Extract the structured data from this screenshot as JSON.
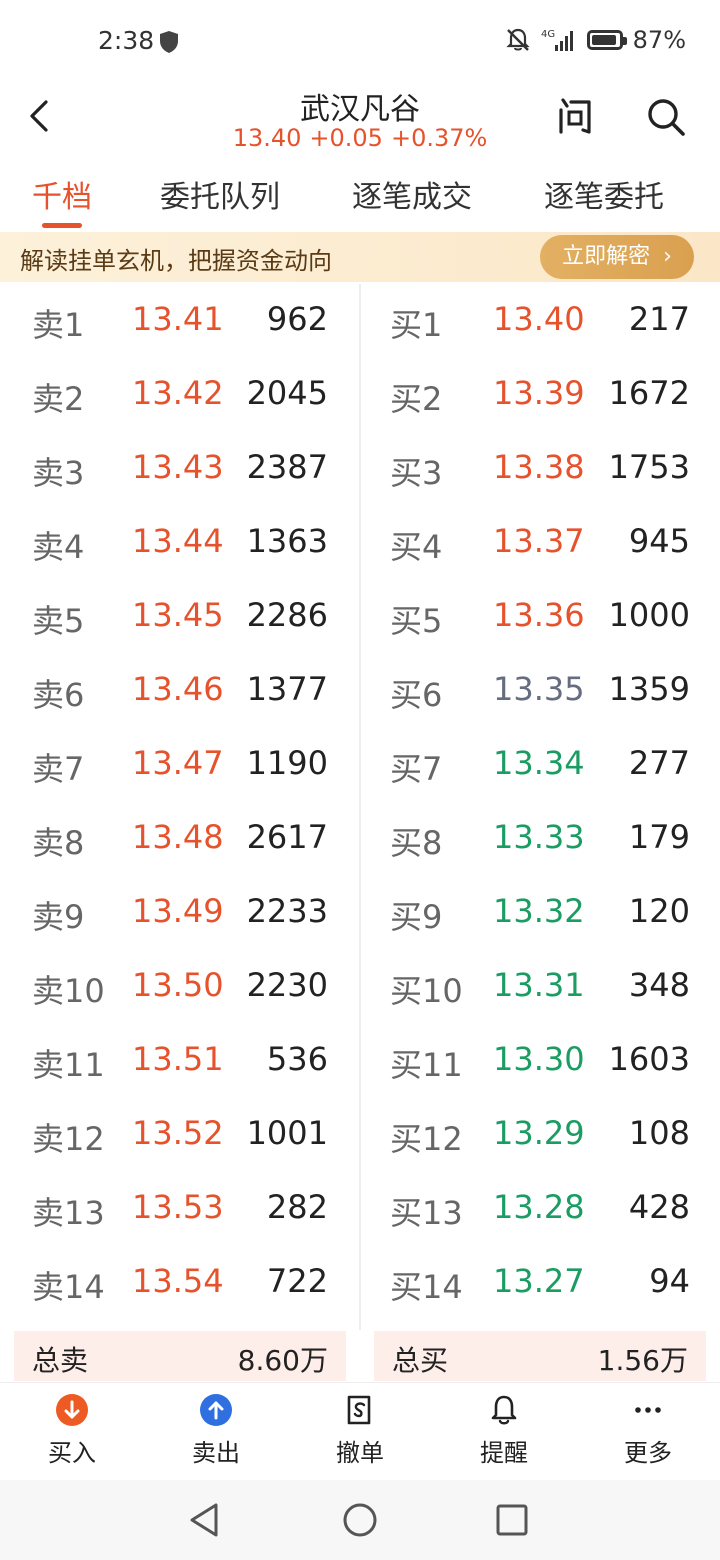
{
  "status": {
    "time": "2:38",
    "signal": "4G",
    "battery": "87%"
  },
  "header": {
    "title": "武汉凡谷",
    "price": "13.40",
    "change": "+0.05",
    "change_pct": "+0.37%"
  },
  "tabs": [
    {
      "label": "千档",
      "active": true
    },
    {
      "label": "委托队列",
      "active": false
    },
    {
      "label": "逐笔成交",
      "active": false
    },
    {
      "label": "逐笔委托",
      "active": false
    }
  ],
  "banner": {
    "text": "解读挂单玄机，把握资金动向",
    "button": "立即解密"
  },
  "colors": {
    "up": "#e6522c",
    "down": "#1a9c62",
    "flat": "#666d80"
  },
  "sell": [
    {
      "label": "卖1",
      "price": "13.41",
      "vol": "962",
      "trend": "up"
    },
    {
      "label": "卖2",
      "price": "13.42",
      "vol": "2045",
      "trend": "up"
    },
    {
      "label": "卖3",
      "price": "13.43",
      "vol": "2387",
      "trend": "up"
    },
    {
      "label": "卖4",
      "price": "13.44",
      "vol": "1363",
      "trend": "up"
    },
    {
      "label": "卖5",
      "price": "13.45",
      "vol": "2286",
      "trend": "up"
    },
    {
      "label": "卖6",
      "price": "13.46",
      "vol": "1377",
      "trend": "up"
    },
    {
      "label": "卖7",
      "price": "13.47",
      "vol": "1190",
      "trend": "up"
    },
    {
      "label": "卖8",
      "price": "13.48",
      "vol": "2617",
      "trend": "up"
    },
    {
      "label": "卖9",
      "price": "13.49",
      "vol": "2233",
      "trend": "up"
    },
    {
      "label": "卖10",
      "price": "13.50",
      "vol": "2230",
      "trend": "up"
    },
    {
      "label": "卖11",
      "price": "13.51",
      "vol": "536",
      "trend": "up"
    },
    {
      "label": "卖12",
      "price": "13.52",
      "vol": "1001",
      "trend": "up"
    },
    {
      "label": "卖13",
      "price": "13.53",
      "vol": "282",
      "trend": "up"
    },
    {
      "label": "卖14",
      "price": "13.54",
      "vol": "722",
      "trend": "up"
    }
  ],
  "buy": [
    {
      "label": "买1",
      "price": "13.40",
      "vol": "217",
      "trend": "up"
    },
    {
      "label": "买2",
      "price": "13.39",
      "vol": "1672",
      "trend": "up"
    },
    {
      "label": "买3",
      "price": "13.38",
      "vol": "1753",
      "trend": "up"
    },
    {
      "label": "买4",
      "price": "13.37",
      "vol": "945",
      "trend": "up"
    },
    {
      "label": "买5",
      "price": "13.36",
      "vol": "1000",
      "trend": "up"
    },
    {
      "label": "买6",
      "price": "13.35",
      "vol": "1359",
      "trend": "flat"
    },
    {
      "label": "买7",
      "price": "13.34",
      "vol": "277",
      "trend": "down"
    },
    {
      "label": "买8",
      "price": "13.33",
      "vol": "179",
      "trend": "down"
    },
    {
      "label": "买9",
      "price": "13.32",
      "vol": "120",
      "trend": "down"
    },
    {
      "label": "买10",
      "price": "13.31",
      "vol": "348",
      "trend": "down"
    },
    {
      "label": "买11",
      "price": "13.30",
      "vol": "1603",
      "trend": "down"
    },
    {
      "label": "买12",
      "price": "13.29",
      "vol": "108",
      "trend": "down"
    },
    {
      "label": "买13",
      "price": "13.28",
      "vol": "428",
      "trend": "down"
    },
    {
      "label": "买14",
      "price": "13.27",
      "vol": "94",
      "trend": "down"
    }
  ],
  "totals": {
    "sell_label": "总卖",
    "sell_value": "8.60万",
    "buy_label": "总买",
    "buy_value": "1.56万"
  },
  "bottom": [
    {
      "label": "买入",
      "icon": "buy-icon"
    },
    {
      "label": "卖出",
      "icon": "sell-icon"
    },
    {
      "label": "撤单",
      "icon": "cancel-order-icon"
    },
    {
      "label": "提醒",
      "icon": "bell-icon"
    },
    {
      "label": "更多",
      "icon": "more-icon"
    }
  ]
}
